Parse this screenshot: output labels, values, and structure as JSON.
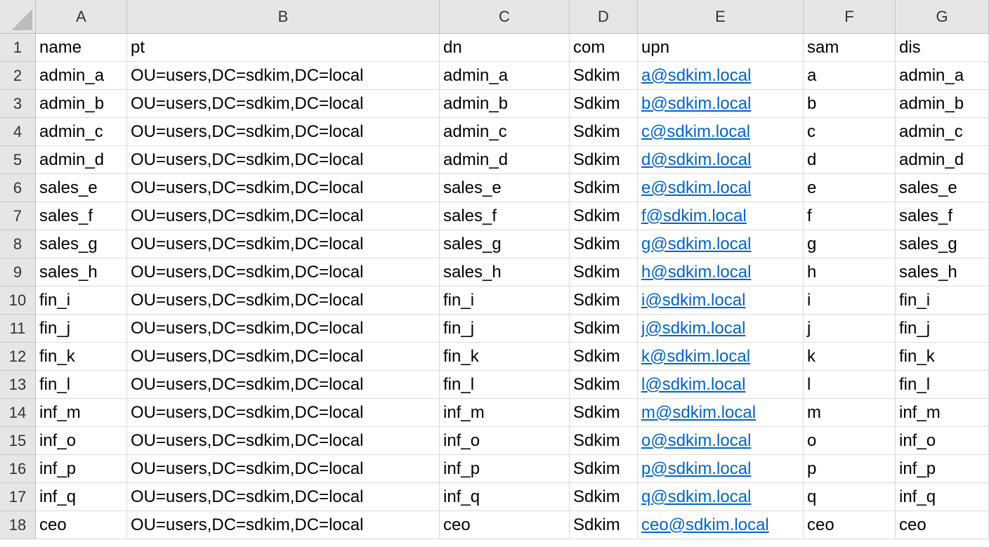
{
  "columns": [
    "A",
    "B",
    "C",
    "D",
    "E",
    "F",
    "G"
  ],
  "header_row": [
    "name",
    "pt",
    "dn",
    "com",
    "upn",
    "sam",
    "dis"
  ],
  "rows": [
    [
      "admin_a",
      "OU=users,DC=sdkim,DC=local",
      "admin_a",
      "Sdkim",
      "a@sdkim.local",
      "a",
      "admin_a"
    ],
    [
      "admin_b",
      "OU=users,DC=sdkim,DC=local",
      "admin_b",
      "Sdkim",
      "b@sdkim.local",
      "b",
      "admin_b"
    ],
    [
      "admin_c",
      "OU=users,DC=sdkim,DC=local",
      "admin_c",
      "Sdkim",
      "c@sdkim.local",
      "c",
      "admin_c"
    ],
    [
      "admin_d",
      "OU=users,DC=sdkim,DC=local",
      "admin_d",
      "Sdkim",
      "d@sdkim.local",
      "d",
      "admin_d"
    ],
    [
      "sales_e",
      "OU=users,DC=sdkim,DC=local",
      "sales_e",
      "Sdkim",
      "e@sdkim.local",
      "e",
      "sales_e"
    ],
    [
      "sales_f",
      "OU=users,DC=sdkim,DC=local",
      "sales_f",
      "Sdkim",
      "f@sdkim.local",
      "f",
      "sales_f"
    ],
    [
      "sales_g",
      "OU=users,DC=sdkim,DC=local",
      "sales_g",
      "Sdkim",
      "g@sdkim.local",
      "g",
      "sales_g"
    ],
    [
      "sales_h",
      "OU=users,DC=sdkim,DC=local",
      "sales_h",
      "Sdkim",
      "h@sdkim.local",
      "h",
      "sales_h"
    ],
    [
      "fin_i",
      "OU=users,DC=sdkim,DC=local",
      "fin_i",
      "Sdkim",
      "i@sdkim.local",
      "i",
      "fin_i"
    ],
    [
      "fin_j",
      "OU=users,DC=sdkim,DC=local",
      "fin_j",
      "Sdkim",
      "j@sdkim.local",
      "j",
      "fin_j"
    ],
    [
      "fin_k",
      "OU=users,DC=sdkim,DC=local",
      "fin_k",
      "Sdkim",
      "k@sdkim.local",
      "k",
      "fin_k"
    ],
    [
      "fin_l",
      "OU=users,DC=sdkim,DC=local",
      "fin_l",
      "Sdkim",
      "l@sdkim.local",
      "l",
      "fin_l"
    ],
    [
      "inf_m",
      "OU=users,DC=sdkim,DC=local",
      "inf_m",
      "Sdkim",
      "m@sdkim.local",
      "m",
      "inf_m"
    ],
    [
      "inf_o",
      "OU=users,DC=sdkim,DC=local",
      "inf_o",
      "Sdkim",
      "o@sdkim.local",
      "o",
      "inf_o"
    ],
    [
      "inf_p",
      "OU=users,DC=sdkim,DC=local",
      "inf_p",
      "Sdkim",
      "p@sdkim.local",
      "p",
      "inf_p"
    ],
    [
      "inf_q",
      "OU=users,DC=sdkim,DC=local",
      "inf_q",
      "Sdkim",
      "q@sdkim.local",
      "q",
      "inf_q"
    ],
    [
      "ceo",
      "OU=users,DC=sdkim,DC=local",
      "ceo",
      "Sdkim",
      "ceo@sdkim.local",
      "ceo",
      "ceo"
    ]
  ],
  "row_numbers": [
    "1",
    "2",
    "3",
    "4",
    "5",
    "6",
    "7",
    "8",
    "9",
    "10",
    "11",
    "12",
    "13",
    "14",
    "15",
    "16",
    "17",
    "18"
  ],
  "colors": {
    "header_bg": "#e6e6e6",
    "link": "#0563c1",
    "gridline": "#dadada"
  }
}
